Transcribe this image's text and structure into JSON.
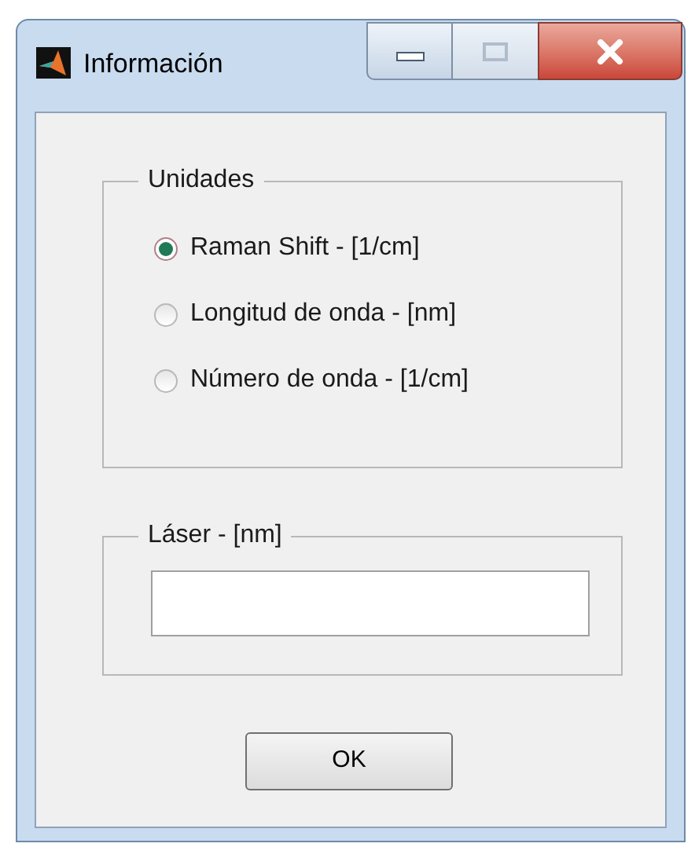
{
  "window": {
    "title": "Información"
  },
  "units_group": {
    "title": "Unidades",
    "options": [
      {
        "label": "Raman Shift - [1/cm]",
        "selected": true
      },
      {
        "label": "Longitud de onda - [nm]",
        "selected": false
      },
      {
        "label": "Número de onda - [1/cm]",
        "selected": false
      }
    ]
  },
  "laser_group": {
    "title": "Láser - [nm]"
  },
  "buttons": [
    "OK"
  ]
}
